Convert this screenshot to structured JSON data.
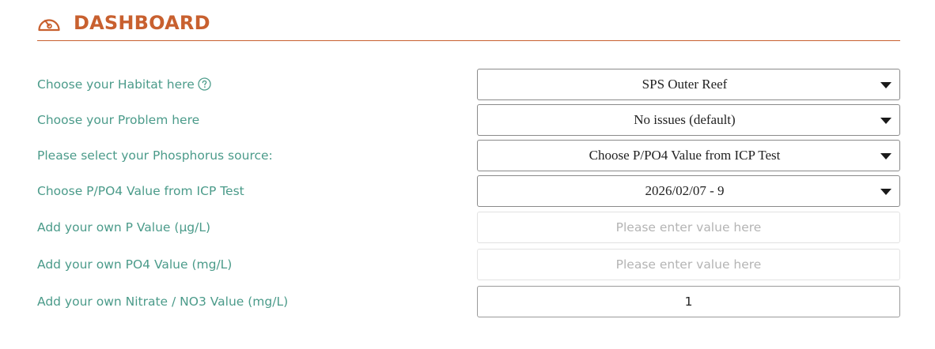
{
  "header": {
    "title": "DASHBOARD",
    "icon": "gauge-icon",
    "accent_color": "#c8602f"
  },
  "label_color": "#4b9b8a",
  "form": {
    "habitat": {
      "label": "Choose your Habitat here",
      "help_icon": "question-circle-icon",
      "value": "SPS Outer Reef"
    },
    "problem": {
      "label": "Choose your Problem here",
      "value": "No issues (default)"
    },
    "phosphorus_source": {
      "label": "Please select your Phosphorus source:",
      "value": "Choose P/PO4 Value from ICP Test"
    },
    "icp_value": {
      "label": "Choose P/PO4 Value from ICP Test",
      "value": "2026/02/07 - 9"
    },
    "p_value": {
      "label": "Add your own P Value (µg/L)",
      "value": "",
      "placeholder": "Please enter value here"
    },
    "po4_value": {
      "label": "Add your own PO4 Value (mg/L)",
      "value": "",
      "placeholder": "Please enter value here"
    },
    "nitrate_value": {
      "label": "Add your own Nitrate / NO3 Value (mg/L)",
      "value": "1",
      "placeholder": ""
    }
  }
}
